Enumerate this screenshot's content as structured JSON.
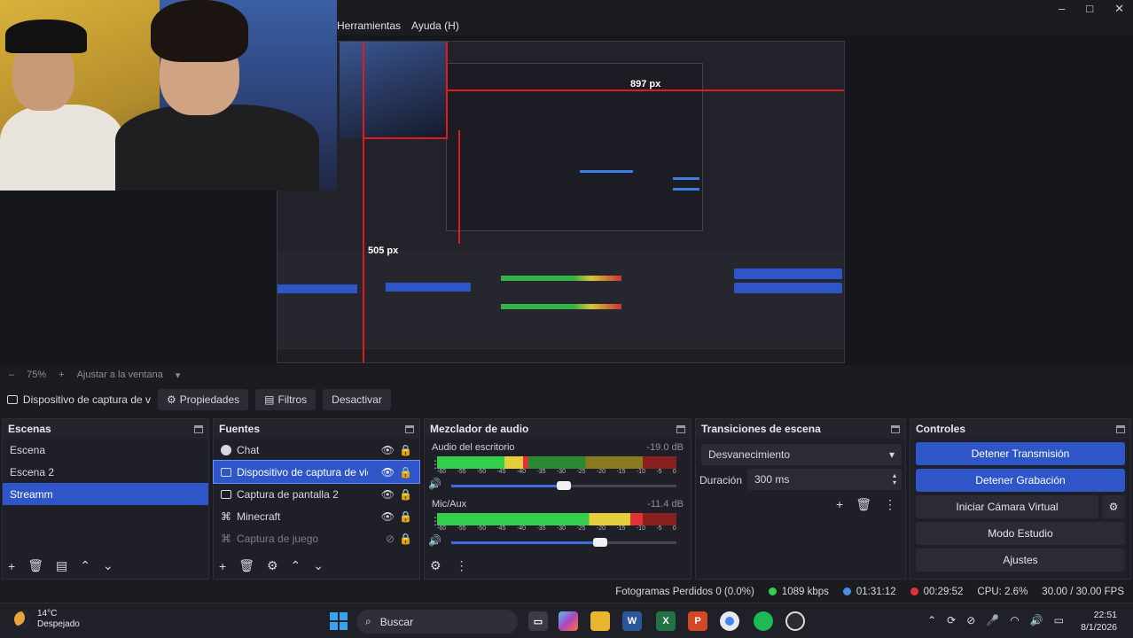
{
  "window": {
    "minimize": "–",
    "maximize": "□",
    "close": "✕"
  },
  "menu": {
    "items": [
      "Herramientas",
      "Ayuda (H)"
    ]
  },
  "preview": {
    "label_width": "897 px",
    "label_height": "505 px"
  },
  "zoom": {
    "value": "75%",
    "fit": "Ajustar a la ventana"
  },
  "source_toolbar": {
    "source_name": "Dispositivo de captura de v",
    "properties": "Propiedades",
    "filters": "Filtros",
    "deactivate": "Desactivar"
  },
  "scenes": {
    "title": "Escenas",
    "items": [
      "Escena",
      "Escena 2",
      "Streamm"
    ],
    "selected": "Streamm"
  },
  "sources": {
    "title": "Fuentes",
    "items": [
      {
        "label": "Chat",
        "icon": "chat-icon"
      },
      {
        "label": "Dispositivo de captura de vid",
        "icon": "camera-icon"
      },
      {
        "label": "Captura de pantalla 2",
        "icon": "monitor-icon"
      },
      {
        "label": "Minecraft",
        "icon": "gamepad-icon"
      },
      {
        "label": "Captura de juego",
        "icon": "gamepad-icon"
      }
    ]
  },
  "mixer": {
    "title": "Mezclador de audio",
    "channels": [
      {
        "name": "Audio del escritorio",
        "db": "-19.0 dB",
        "level": 0.38,
        "volume": 0.5
      },
      {
        "name": "Mic/Aux",
        "db": "-11.4 dB",
        "level": 0.86,
        "volume": 0.66
      }
    ],
    "scale": [
      "-60",
      "-55",
      "-50",
      "-45",
      "-40",
      "-35",
      "-30",
      "-25",
      "-20",
      "-15",
      "-10",
      "-5",
      "0"
    ]
  },
  "transitions": {
    "title": "Transiciones de escena",
    "selected": "Desvanecimiento",
    "duration_label": "Duración",
    "duration_value": "300 ms"
  },
  "controls": {
    "title": "Controles",
    "stop_stream": "Detener Transmisión",
    "stop_recording": "Detener Grabación",
    "virtual_cam": "Iniciar Cámara Virtual",
    "studio_mode": "Modo Estudio",
    "settings": "Ajustes"
  },
  "status": {
    "dropped": "Fotogramas Perdidos 0 (0.0%)",
    "bitrate": "1089 kbps",
    "stream_time": "01:31:12",
    "rec_time": "00:29:52",
    "cpu": "CPU: 2.6%",
    "fps": "30.00 / 30.00 FPS"
  },
  "taskbar": {
    "temp": "14°C",
    "weather": "Despejado",
    "search": "Buscar",
    "time": "22:51",
    "date": "8/1/2026"
  },
  "colors": {
    "accent": "#2f56c8",
    "bg": "#1b1c22",
    "panel": "#1f2027",
    "rec_red": "#e03434"
  }
}
